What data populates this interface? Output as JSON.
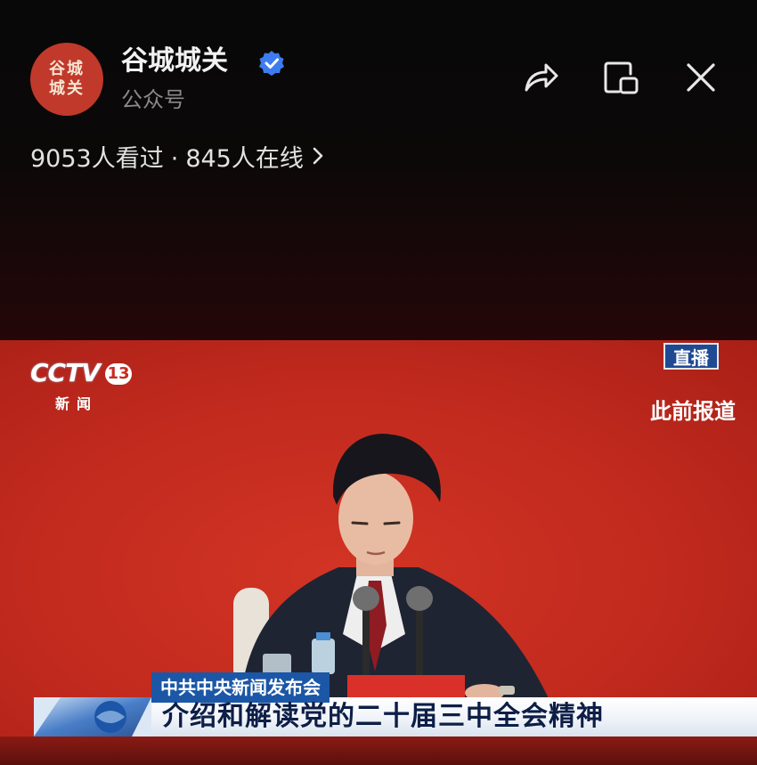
{
  "header": {
    "avatar_line1": "谷城",
    "avatar_line2": "城关",
    "account_name": "谷城城关",
    "account_type": "公众号",
    "views": "9053人看过",
    "separator": "·",
    "online": "845人在线",
    "icons": [
      "verified-badge-icon",
      "share-icon",
      "floating-window-icon",
      "close-icon",
      "chevron-right-icon"
    ]
  },
  "video": {
    "channel_logo": "CCTV",
    "channel_number": "13",
    "channel_sub": "新闻",
    "live_badge": "直播",
    "previous_report": "此前报道",
    "lower_third_top": "中共中央新闻发布会",
    "lower_third_main": "介绍和解读党的二十届三中全会精神"
  },
  "colors": {
    "background": "#000000",
    "video_red": "#c12a1e",
    "badge_blue": "#1f4a93",
    "verified_blue": "#3d7cf0",
    "lower_third_blue": "#1b57a6"
  }
}
